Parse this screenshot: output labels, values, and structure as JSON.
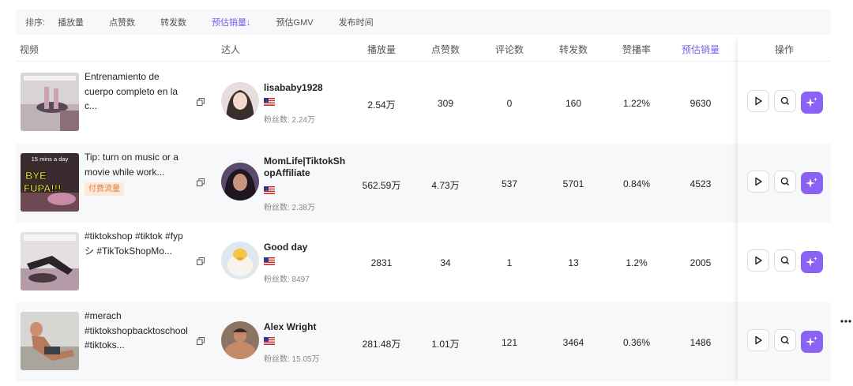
{
  "sort": {
    "label": "排序:",
    "options": [
      "播放量",
      "点赞数",
      "转发数",
      "预估销量↓",
      "预估GMV",
      "发布时间"
    ]
  },
  "columns": {
    "video": "视频",
    "creator": "达人",
    "plays": "播放量",
    "likes": "点赞数",
    "comments": "评论数",
    "shares": "转发数",
    "like_rate": "赞播率",
    "est_sales": "预估销量",
    "actions": "操作"
  },
  "rows": [
    {
      "title": "Entrenamiento de cuerpo completo en la c...",
      "tag": "",
      "creator": "lisababy1928",
      "fans": "粉丝数: 2.24万",
      "plays": "2.54万",
      "likes": "309",
      "comments": "0",
      "shares": "160",
      "like_rate": "1.22%",
      "est_sales": "9630"
    },
    {
      "title": "Tip: turn on music or a movie while work...",
      "tag": "付费流量",
      "creator": "MomLife|TiktokShopAffiliate",
      "fans": "粉丝数: 2.38万",
      "plays": "562.59万",
      "likes": "4.73万",
      "comments": "537",
      "shares": "5701",
      "like_rate": "0.84%",
      "est_sales": "4523"
    },
    {
      "title": "#tiktokshop #tiktok #fypシ #TikTokShopMo...",
      "tag": "",
      "creator": "Good day",
      "fans": "粉丝数: 8497",
      "plays": "2831",
      "likes": "34",
      "comments": "1",
      "shares": "13",
      "like_rate": "1.2%",
      "est_sales": "2005"
    },
    {
      "title": "#merach #tiktokshopbacktoschool #tiktoks...",
      "tag": "",
      "creator": "Alex Wright",
      "fans": "粉丝数: 15.05万",
      "plays": "281.48万",
      "likes": "1.01万",
      "comments": "121",
      "shares": "3464",
      "like_rate": "0.36%",
      "est_sales": "1486"
    }
  ],
  "thumb_texts": {
    "row2_top": "15 mins a day",
    "row2_mid": "BYE",
    "row2_bot": "FUPA!!!"
  },
  "icons": {
    "copy": "copy-icon",
    "flag": "us-flag-icon",
    "play": "play-icon",
    "search": "search-icon",
    "ai": "ai-sparkle-icon",
    "more": "more-dots-icon"
  },
  "colors": {
    "accent": "#7b5cf0",
    "ai_button": "#8a63f5",
    "tag_bg": "#fde9dc",
    "tag_text": "#e07a3c",
    "alt_row": "#f7f8fa"
  }
}
